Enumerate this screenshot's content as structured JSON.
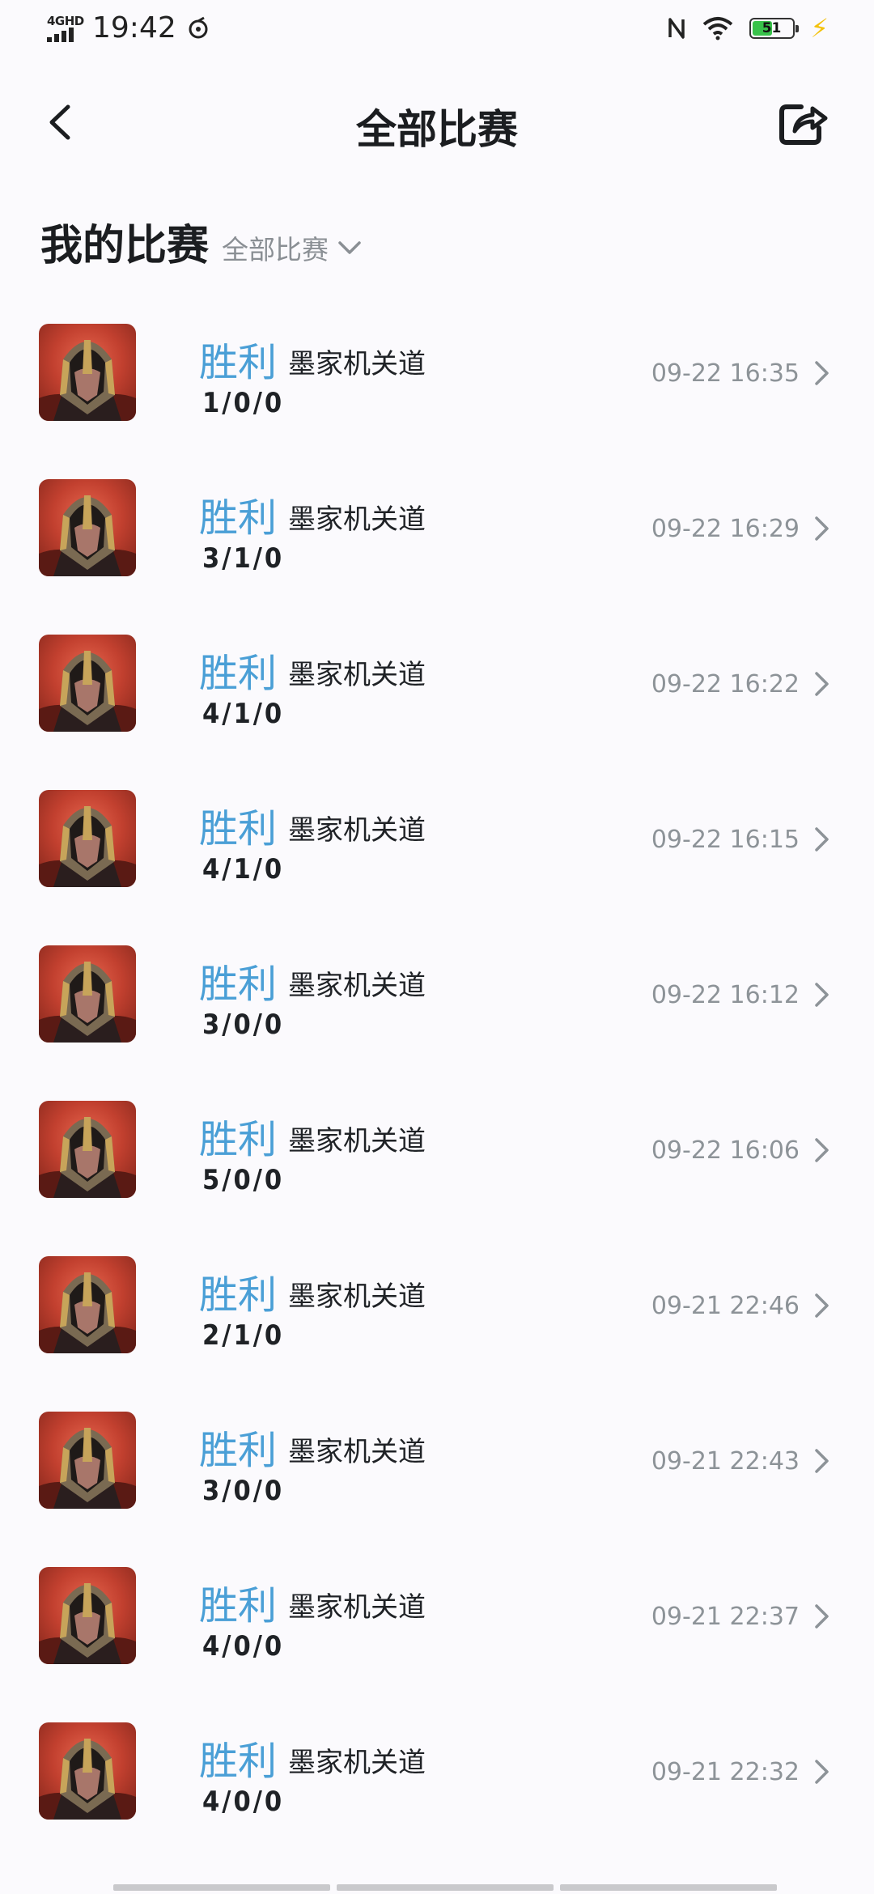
{
  "status_bar": {
    "network": "4GHD",
    "time": "19:42",
    "battery": "51",
    "battery_level": 0.51
  },
  "header": {
    "title": "全部比赛"
  },
  "section": {
    "title": "我的比赛",
    "filter_label": "全部比赛"
  },
  "colors": {
    "result_win": "#4a9fd6",
    "background": "#fbfafd",
    "battery_green": "#38c24a"
  },
  "matches": [
    {
      "result": "胜利",
      "mode": "墨家机关道",
      "kda": "1/0/0",
      "time": "09-22 16:35"
    },
    {
      "result": "胜利",
      "mode": "墨家机关道",
      "kda": "3/1/0",
      "time": "09-22 16:29"
    },
    {
      "result": "胜利",
      "mode": "墨家机关道",
      "kda": "4/1/0",
      "time": "09-22 16:22"
    },
    {
      "result": "胜利",
      "mode": "墨家机关道",
      "kda": "4/1/0",
      "time": "09-22 16:15"
    },
    {
      "result": "胜利",
      "mode": "墨家机关道",
      "kda": "3/0/0",
      "time": "09-22 16:12"
    },
    {
      "result": "胜利",
      "mode": "墨家机关道",
      "kda": "5/0/0",
      "time": "09-22 16:06"
    },
    {
      "result": "胜利",
      "mode": "墨家机关道",
      "kda": "2/1/0",
      "time": "09-21 22:46"
    },
    {
      "result": "胜利",
      "mode": "墨家机关道",
      "kda": "3/0/0",
      "time": "09-21 22:43"
    },
    {
      "result": "胜利",
      "mode": "墨家机关道",
      "kda": "4/0/0",
      "time": "09-21 22:37"
    },
    {
      "result": "胜利",
      "mode": "墨家机关道",
      "kda": "4/0/0",
      "time": "09-21 22:32"
    }
  ]
}
